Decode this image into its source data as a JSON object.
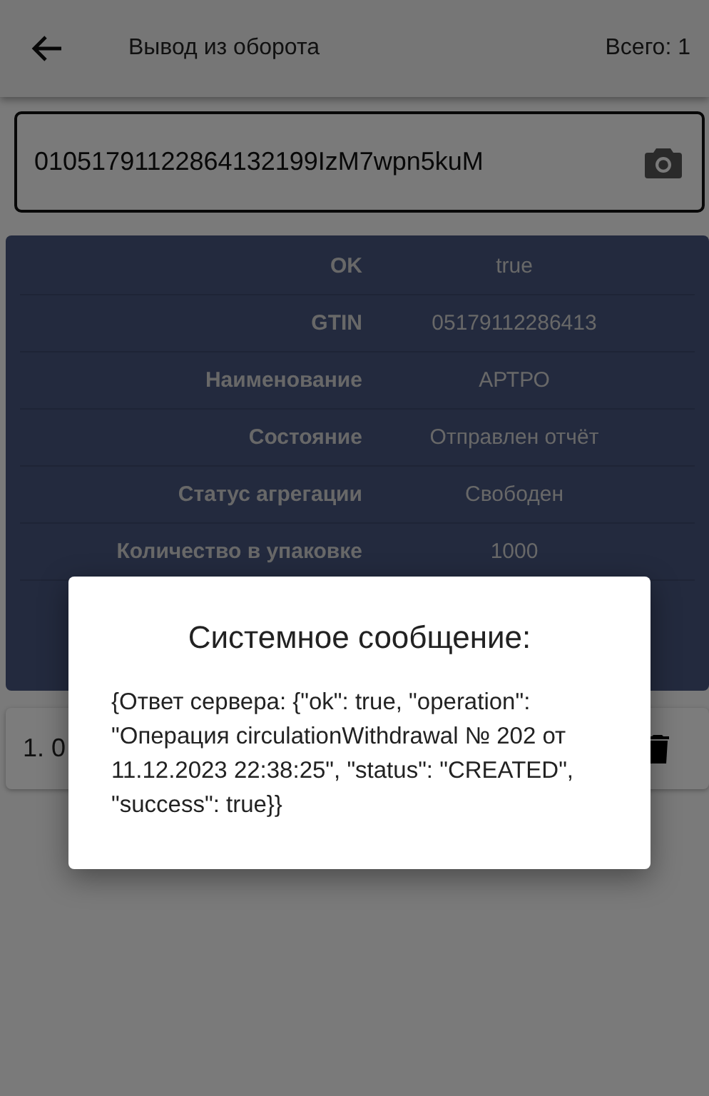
{
  "app_bar": {
    "title": "Вывод из оборота",
    "total": "Всего: 1"
  },
  "code_field": {
    "value": "01051791122864132199IzM7wpn5kuM"
  },
  "details": [
    {
      "label": "OK",
      "value": "true"
    },
    {
      "label": "GTIN",
      "value": "05179112286413"
    },
    {
      "label": "Наименование",
      "value": "АРТРО"
    },
    {
      "label": "Состояние",
      "value": "Отправлен отчёт"
    },
    {
      "label": "Статус агрегации",
      "value": "Свободен"
    },
    {
      "label": "Количество в упаковке",
      "value": "1000"
    }
  ],
  "list_items": [
    {
      "text": "1. 0"
    }
  ],
  "dialog": {
    "title": "Системное сообщение:",
    "message": "{Ответ сервера: {\"ok\": true, \"operation\": \"Операция circulationWithdrawal № 202 от 11.12.2023 22:38:25\", \"status\": \"CREATED\", \"success\": true}}"
  }
}
